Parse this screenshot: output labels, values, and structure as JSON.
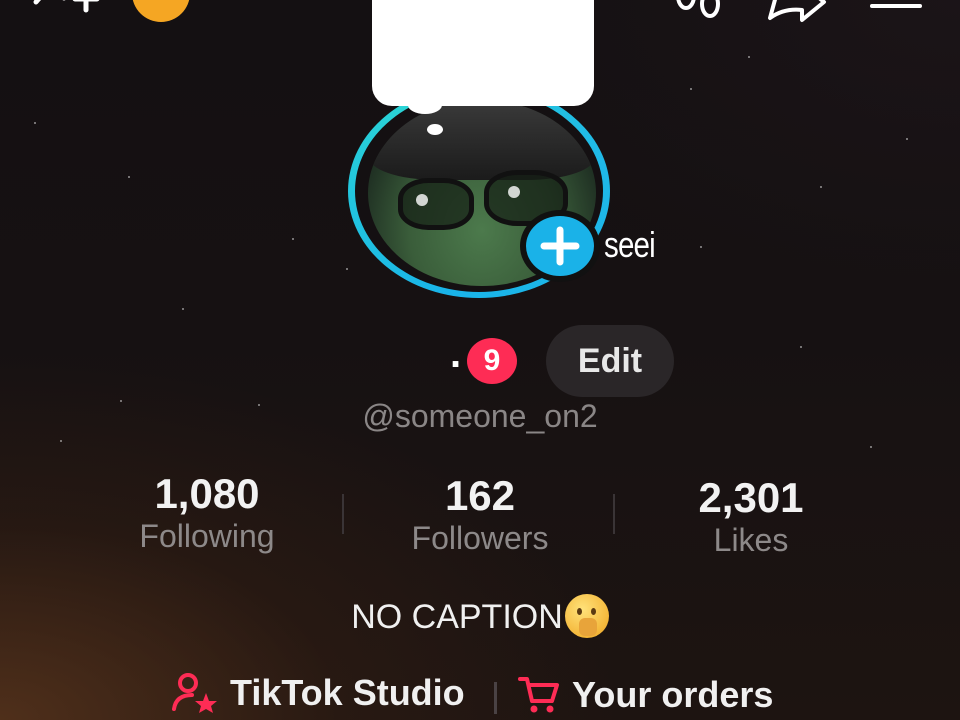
{
  "header": {
    "icons": [
      "add-friend-icon",
      "coin-icon",
      "footprints-icon",
      "share-icon",
      "menu-icon"
    ]
  },
  "profile": {
    "avatar_caption": "seei",
    "display_name": ".",
    "notification_count": "9",
    "edit_label": "Edit",
    "handle": "@someone_on2",
    "bio": "NO CAPTION"
  },
  "stats": [
    {
      "value": "1,080",
      "label": "Following"
    },
    {
      "value": "162",
      "label": "Followers"
    },
    {
      "value": "2,301",
      "label": "Likes"
    }
  ],
  "links": {
    "studio_label": "TikTok Studio",
    "orders_label": "Your orders"
  },
  "colors": {
    "accent_pink": "#fe2c55",
    "accent_cyan": "#1ab2e8",
    "coin": "#f5a623"
  }
}
